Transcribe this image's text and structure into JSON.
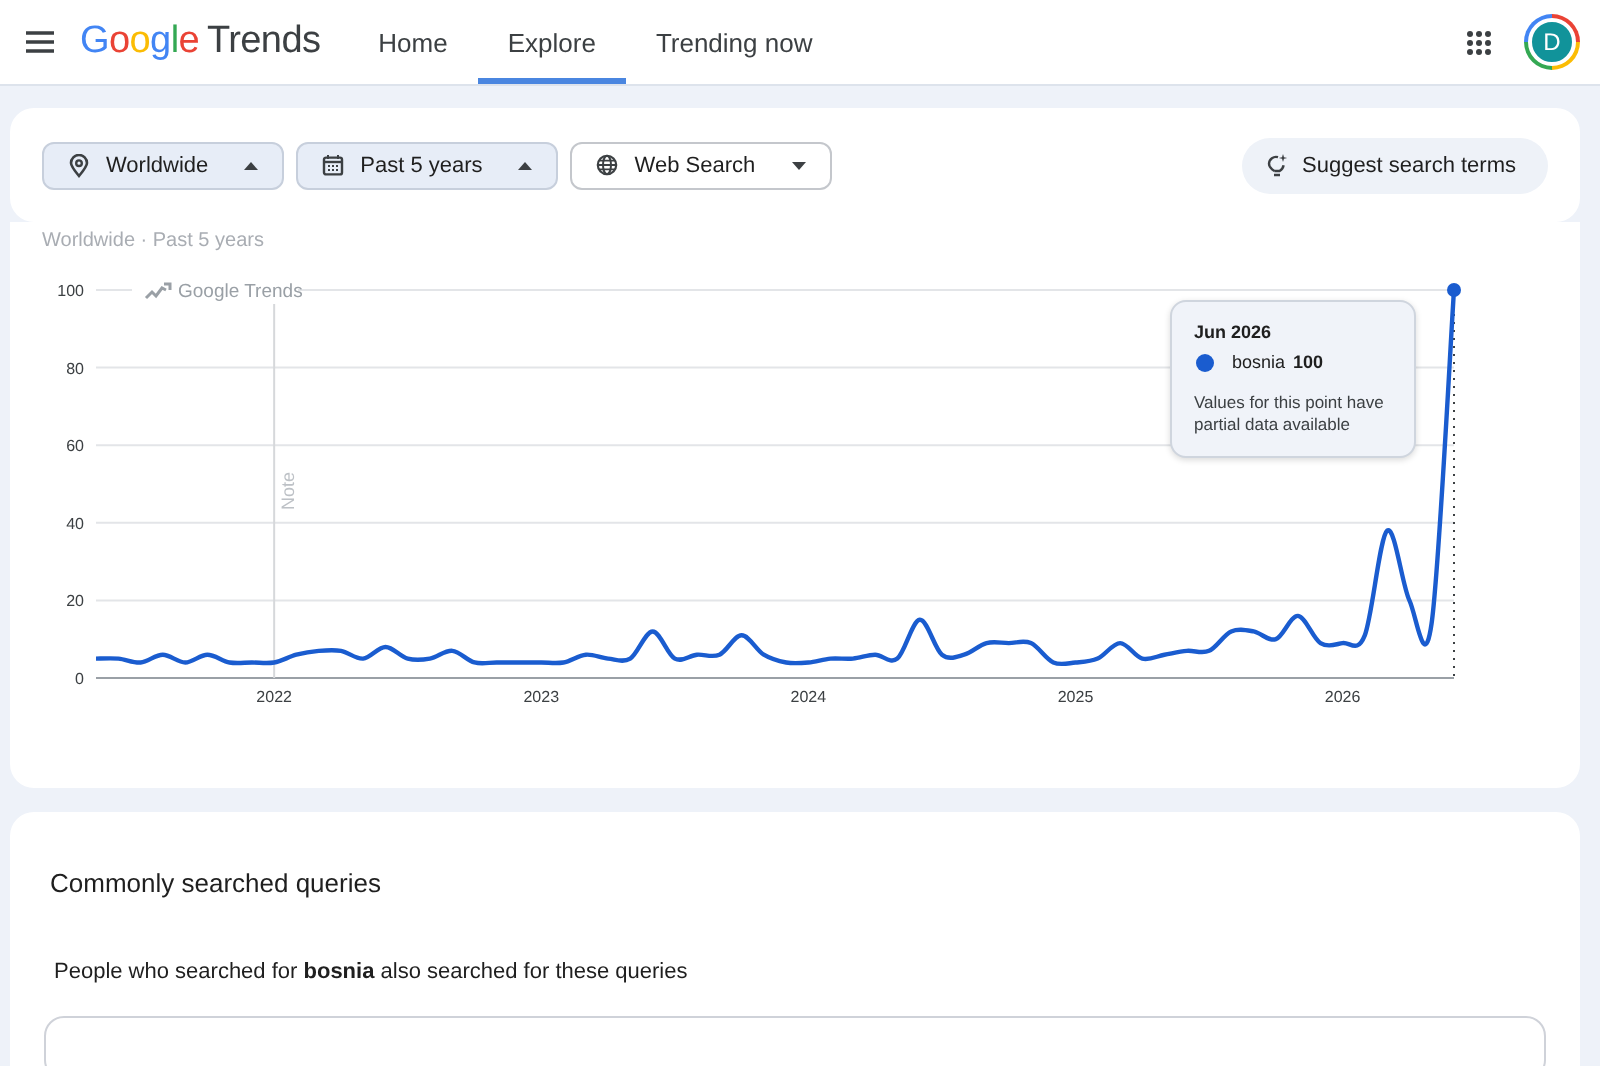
{
  "header": {
    "logo": {
      "brand": "Google",
      "product": "Trends"
    },
    "tabs": [
      {
        "label": "Home",
        "selected": false
      },
      {
        "label": "Explore",
        "selected": true
      },
      {
        "label": "Trending now",
        "selected": false
      }
    ],
    "avatar": "D"
  },
  "filters": {
    "chips": [
      {
        "kind": "location",
        "label": "Worldwide",
        "active": true
      },
      {
        "kind": "time",
        "label": "Past 5 years",
        "active": true
      },
      {
        "kind": "web",
        "label": "Web Search",
        "active": false
      }
    ],
    "suggest_button": "Suggest search terms"
  },
  "interest": {
    "subtitle": "Worldwide · Past 5 years",
    "brand_label": "Google Trends",
    "tooltip": {
      "date": "Jun 2026",
      "value": "100",
      "message": "Values for this point have partial data available"
    },
    "chart_data": {
      "type": "line",
      "grid": true,
      "ref_lines": [
        {
          "axis": "x",
          "value": 2022,
          "label": "Note"
        }
      ],
      "ylim": [
        0,
        100
      ],
      "yticks": [
        0,
        20,
        40,
        60,
        80,
        100
      ],
      "xlim": [
        2021.333,
        2026.417
      ],
      "xticks": [
        2022,
        2023,
        2024,
        2025,
        2026
      ],
      "x": [
        2021.333,
        2021.417,
        2021.5,
        2021.583,
        2021.667,
        2021.75,
        2021.833,
        2021.917,
        2022,
        2022.083,
        2022.167,
        2022.25,
        2022.333,
        2022.417,
        2022.5,
        2022.583,
        2022.667,
        2022.75,
        2022.833,
        2022.917,
        2023,
        2023.083,
        2023.167,
        2023.25,
        2023.333,
        2023.417,
        2023.5,
        2023.583,
        2023.667,
        2023.75,
        2023.833,
        2023.917,
        2024,
        2024.083,
        2024.167,
        2024.25,
        2024.333,
        2024.417,
        2024.5,
        2024.583,
        2024.667,
        2024.75,
        2024.833,
        2024.917,
        2025,
        2025.083,
        2025.167,
        2025.25,
        2025.333,
        2025.417,
        2025.5,
        2025.583,
        2025.667,
        2025.75,
        2025.833,
        2025.917,
        2026,
        2026.083,
        2026.167,
        2026.25,
        2026.333,
        2026.417
      ],
      "series": [
        {
          "name": "bosnia",
          "color": "#1a5ccf",
          "values": [
            5,
            5,
            4,
            6,
            4,
            6,
            4,
            4,
            4,
            6,
            7,
            7,
            5,
            8,
            5,
            5,
            7,
            4,
            4,
            4,
            4,
            4,
            6,
            5,
            5,
            12,
            5,
            6,
            6,
            11,
            6,
            4,
            4,
            5,
            5,
            6,
            5,
            15,
            6,
            6,
            9,
            9,
            9,
            4,
            4,
            5,
            9,
            5,
            6,
            7,
            7,
            12,
            12,
            10,
            16,
            9,
            9,
            11,
            38,
            20,
            14,
            100
          ]
        }
      ]
    }
  },
  "related": {
    "title": "Commonly searched queries",
    "description": "People who searched for **bosnia** also searched for these queries"
  }
}
